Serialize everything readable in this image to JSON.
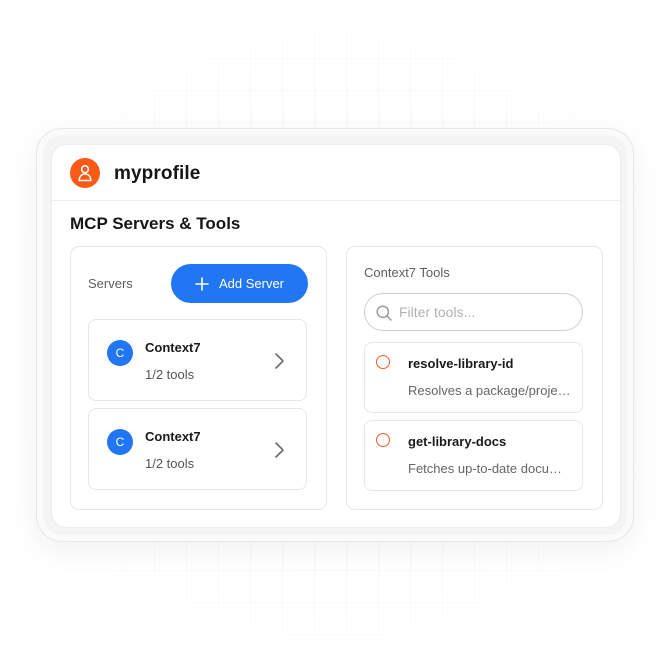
{
  "app": {
    "brand": "myprofile",
    "accent_color": "#fa5a15",
    "primary_color": "#2176f3"
  },
  "page": {
    "title": "MCP Servers & Tools"
  },
  "servers_panel": {
    "label": "Servers",
    "add_button_label": "Add Server",
    "items": [
      {
        "avatar": "C",
        "name": "Context7",
        "tools": "1/2 tools"
      },
      {
        "avatar": "C",
        "name": "Context7",
        "tools": "1/2 tools"
      }
    ]
  },
  "tools_panel": {
    "label": "Context7 Tools",
    "filter_placeholder": "Filter tools...",
    "items": [
      {
        "name": "resolve-library-id",
        "description": "Resolves a package/project name to a library ID"
      },
      {
        "name": "get-library-docs",
        "description": "Fetches up-to-date documentation for a library"
      }
    ]
  },
  "icons": {
    "logo": "user-outline-icon",
    "add": "plus-icon",
    "chevron": "chevron-right-icon",
    "search": "search-icon",
    "radio": "radio-unselected-icon"
  }
}
